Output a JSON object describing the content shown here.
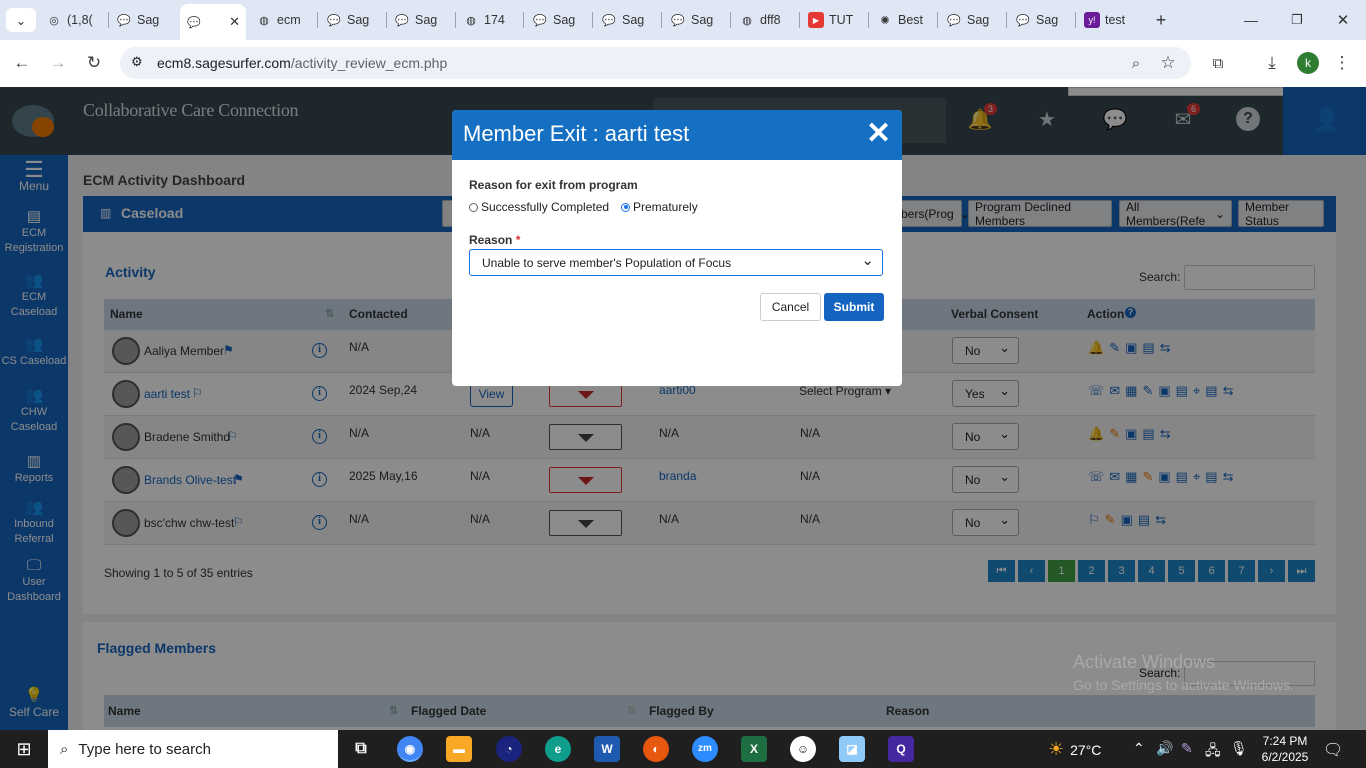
{
  "browser": {
    "tabs": [
      {
        "label": "(1,8("
      },
      {
        "label": "Sag"
      },
      {
        "label": ""
      },
      {
        "label": "ecm"
      },
      {
        "label": "Sag"
      },
      {
        "label": "Sag"
      },
      {
        "label": "174"
      },
      {
        "label": "Sag"
      },
      {
        "label": "Sag"
      },
      {
        "label": "Sag"
      },
      {
        "label": "dff8"
      },
      {
        "label": "TUT"
      },
      {
        "label": "Best"
      },
      {
        "label": "Sag"
      },
      {
        "label": "Sag"
      },
      {
        "label": "test"
      }
    ],
    "url_host": "ecm8.sagesurfer.com",
    "url_path": "/activity_review_ecm.php",
    "profile_letter": "k"
  },
  "app": {
    "brand": "Collaborative Care Connection",
    "notifications_count": "3",
    "messages_count": "6"
  },
  "sidebar": {
    "items": [
      {
        "label": "Menu"
      },
      {
        "label": "ECM Registration"
      },
      {
        "label": "ECM Caseload"
      },
      {
        "label": "CS Caseload"
      },
      {
        "label": "CHW Caseload"
      },
      {
        "label": "Reports"
      },
      {
        "label": "Inbound Referral"
      },
      {
        "label": "User Dashboard"
      },
      {
        "label": "Self Care"
      }
    ]
  },
  "page": {
    "heading": "ECM Activity Dashboard",
    "card_title": "Caseload",
    "header_buttons": {
      "members_prog": "bers(Prog",
      "declined": "Program Declined Members",
      "all_members": "All Members(Refe",
      "status": "Member Status"
    },
    "activity_title": "Activity",
    "search_label": "Search:",
    "columns": {
      "name": "Name",
      "contacted": "Contacted",
      "consent": "Verbal Consent",
      "action": "Action"
    },
    "rows": [
      {
        "name": "Aaliya Member",
        "contacted": "N/A",
        "col3": "",
        "col4": "",
        "col5": "",
        "consent": "No"
      },
      {
        "name": "aarti test",
        "contacted": "2024 Sep,24",
        "col3": "View",
        "col4": "aarti00",
        "col5": "Select Program",
        "consent": "Yes"
      },
      {
        "name": "Bradene Smithd",
        "contacted": "N/A",
        "col3": "N/A",
        "col4": "N/A",
        "col5": "N/A",
        "consent": "No"
      },
      {
        "name": "Brands Olive-test",
        "contacted": "2025 May,16",
        "col3": "N/A",
        "col4": "branda",
        "col5": "N/A",
        "consent": "No"
      },
      {
        "name": "bsc'chw chw-test",
        "contacted": "N/A",
        "col3": "N/A",
        "col4": "N/A",
        "col5": "N/A",
        "consent": "No"
      }
    ],
    "showing": "Showing 1 to 5 of 35 entries",
    "pages": [
      "1",
      "2",
      "3",
      "4",
      "5",
      "6",
      "7"
    ],
    "flagged_title": "Flagged Members",
    "flagged_columns": {
      "name": "Name",
      "date": "Flagged Date",
      "by": "Flagged By",
      "reason": "Reason"
    },
    "flagged_search_label": "Search:"
  },
  "modal": {
    "title": "Member Exit : aarti test",
    "exit_label": "Reason for exit from program",
    "option_completed": "Successfully Completed",
    "option_premature": "Prematurely",
    "selected_option": "Prematurely",
    "reason_label": "Reason",
    "required_mark": "*",
    "reason_value": "Unable to serve member's Population of Focus",
    "cancel": "Cancel",
    "submit": "Submit"
  },
  "watermark": {
    "line1": "Activate Windows",
    "line2": "Go to Settings to activate Windows."
  },
  "taskbar": {
    "search_placeholder": "Type here to search",
    "temperature": "27°C",
    "time": "7:24 PM",
    "date": "6/2/2025"
  },
  "colors": {
    "primary": "#1565c0",
    "header": "#37474f",
    "accent_orange": "#f57c00",
    "page_active": "#43a047"
  }
}
